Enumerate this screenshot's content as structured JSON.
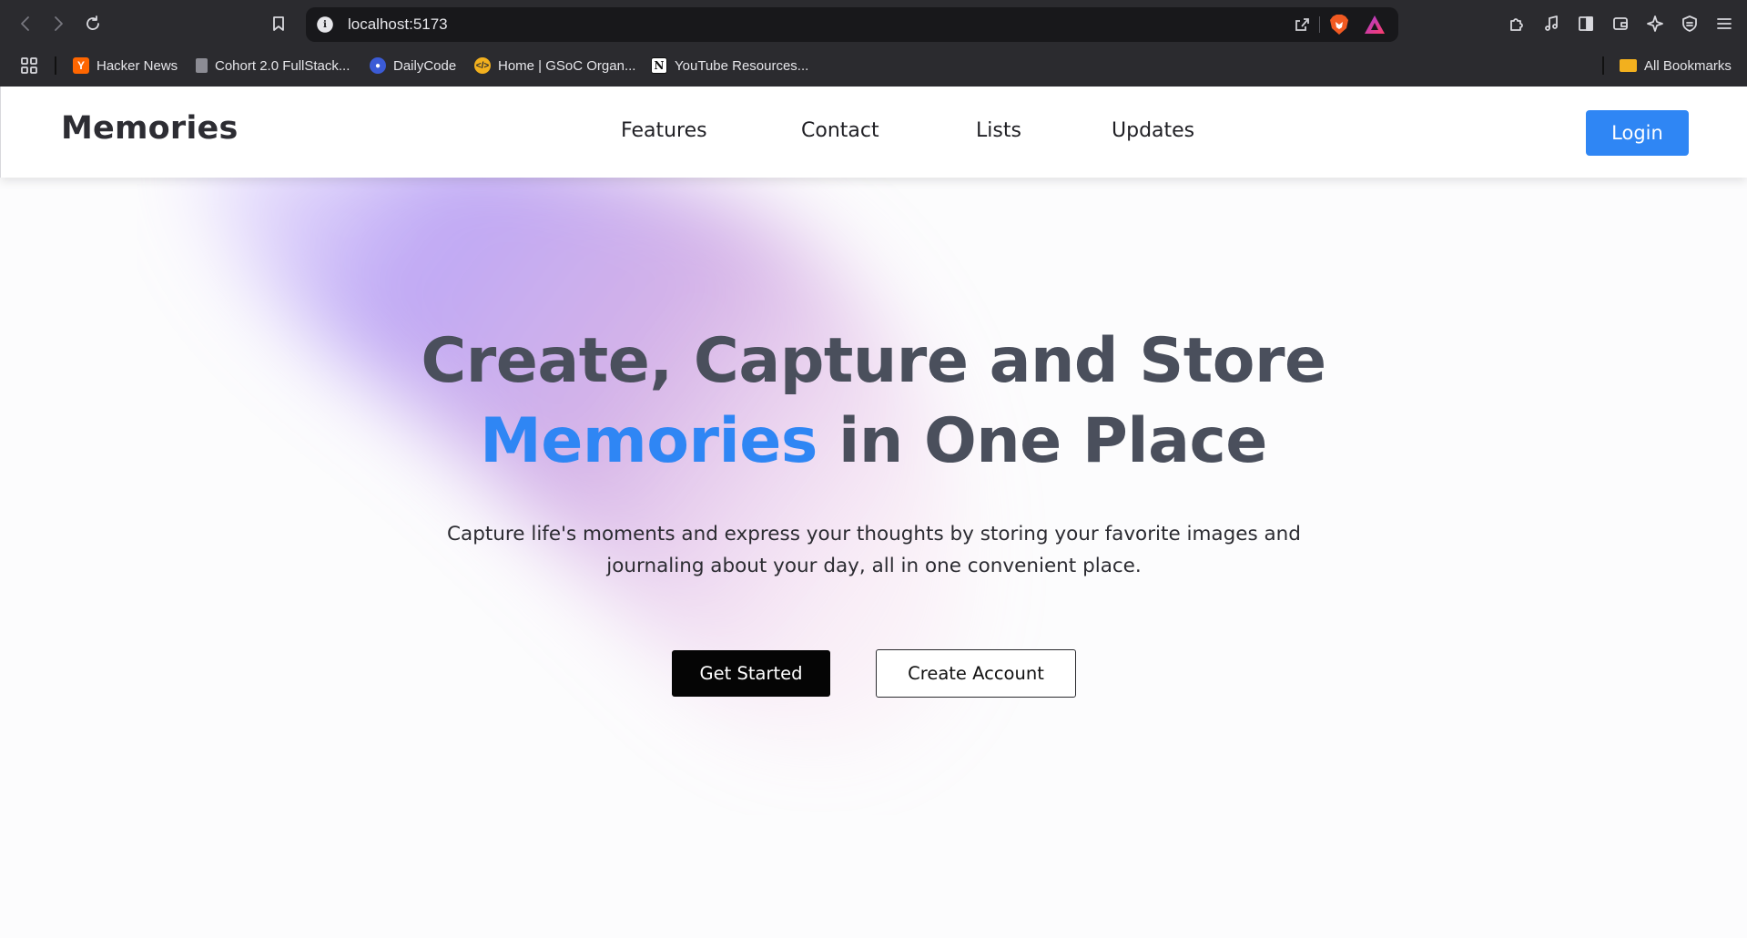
{
  "browser": {
    "url": "localhost:5173",
    "bookmarks": [
      {
        "label": "Hacker News",
        "icon": "hacker-news-icon"
      },
      {
        "label": "Cohort 2.0 FullStack...",
        "icon": "page-icon"
      },
      {
        "label": "DailyCode",
        "icon": "dailycode-icon"
      },
      {
        "label": "Home | GSoC Organ...",
        "icon": "gsoc-icon"
      },
      {
        "label": "YouTube Resources...",
        "icon": "notion-icon"
      }
    ],
    "all_bookmarks_label": "All Bookmarks"
  },
  "navbar": {
    "brand": "Memories",
    "links": [
      "Features",
      "Contact",
      "Lists",
      "Updates"
    ],
    "login_label": "Login"
  },
  "hero": {
    "title_line1": "Create, Capture and Store",
    "title_accent": "Memories",
    "title_line2_rest": " in One Place",
    "subtitle": "Capture life's moments and express your thoughts by storing your favorite images and journaling about your day, all in one convenient place.",
    "primary_button": "Get Started",
    "secondary_button": "Create Account"
  },
  "colors": {
    "accent": "#2f86f4",
    "title_text": "#4a4f5c",
    "chrome_bg": "#2b2b2f"
  }
}
